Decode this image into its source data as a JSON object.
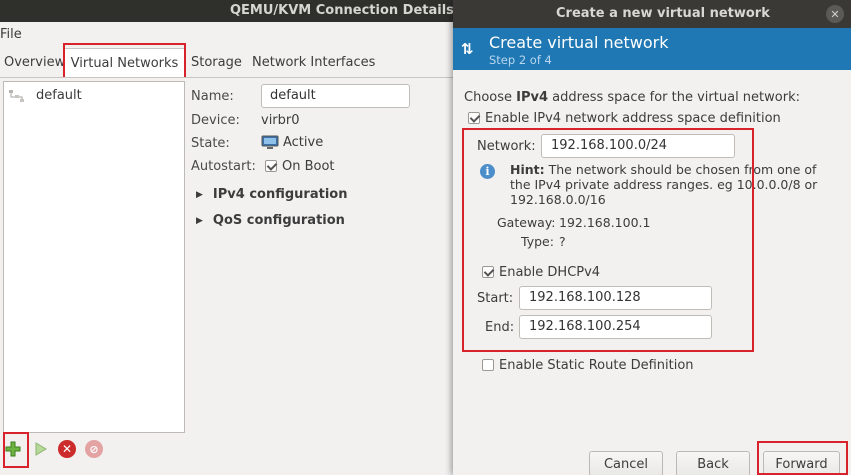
{
  "main_window": {
    "title": "QEMU/KVM Connection Details",
    "menu": {
      "file_label": "File"
    },
    "tabs": [
      {
        "label": "Overview"
      },
      {
        "label": "Virtual Networks"
      },
      {
        "label": "Storage"
      },
      {
        "label": "Network Interfaces"
      }
    ],
    "network_list": [
      {
        "name": "default",
        "icon": "network-icon"
      }
    ],
    "details": {
      "name_label": "Name:",
      "name_value": "default",
      "device_label": "Device:",
      "device_value": "virbr0",
      "state_label": "State:",
      "state_value": "Active",
      "state_icon": "monitor-icon",
      "autostart_label": "Autostart:",
      "autostart_value": "On Boot",
      "autostart_checked": true,
      "ipv4_expander": "IPv4 configuration",
      "qos_expander": "QoS configuration"
    },
    "toolbar": [
      {
        "name": "add-network",
        "icon": "plus-icon",
        "color": "#5aa627"
      },
      {
        "name": "start-network",
        "icon": "play-icon",
        "color": "#9bc77a"
      },
      {
        "name": "stop-network",
        "icon": "stop-icon",
        "color": "#d32f2f"
      },
      {
        "name": "delete-network",
        "icon": "delete-icon",
        "color": "#e38a8a"
      }
    ]
  },
  "dialog": {
    "window_title": "Create a new virtual network",
    "header_title": "Create virtual network",
    "header_subtitle": "Step 2 of 4",
    "header_color": "#1f78b4",
    "intro_prefix": "Choose ",
    "intro_bold": "IPv4",
    "intro_suffix": " address space for the virtual network:",
    "enable_ipv4_label": "Enable IPv4 network address space definition",
    "enable_ipv4_checked": true,
    "network_label": "Network:",
    "network_value": "192.168.100.0/24",
    "hint_bold": "Hint:",
    "hint_text": " The network should be chosen from one of the IPv4 private address ranges. eg 10.0.0.0/8 or 192.168.0.0/16",
    "gateway_label": "Gateway:",
    "gateway_value": "192.168.100.1",
    "type_label": "Type:",
    "type_value": "?",
    "enable_dhcp_label": "Enable DHCPv4",
    "enable_dhcp_checked": true,
    "start_label": "Start:",
    "start_value": "192.168.100.128",
    "end_label": "End:",
    "end_value": "192.168.100.254",
    "static_route_label": "Enable Static Route Definition",
    "static_route_checked": false,
    "buttons": {
      "cancel": "Cancel",
      "back": "Back",
      "forward": "Forward"
    }
  },
  "highlight_color": "#d9232c"
}
